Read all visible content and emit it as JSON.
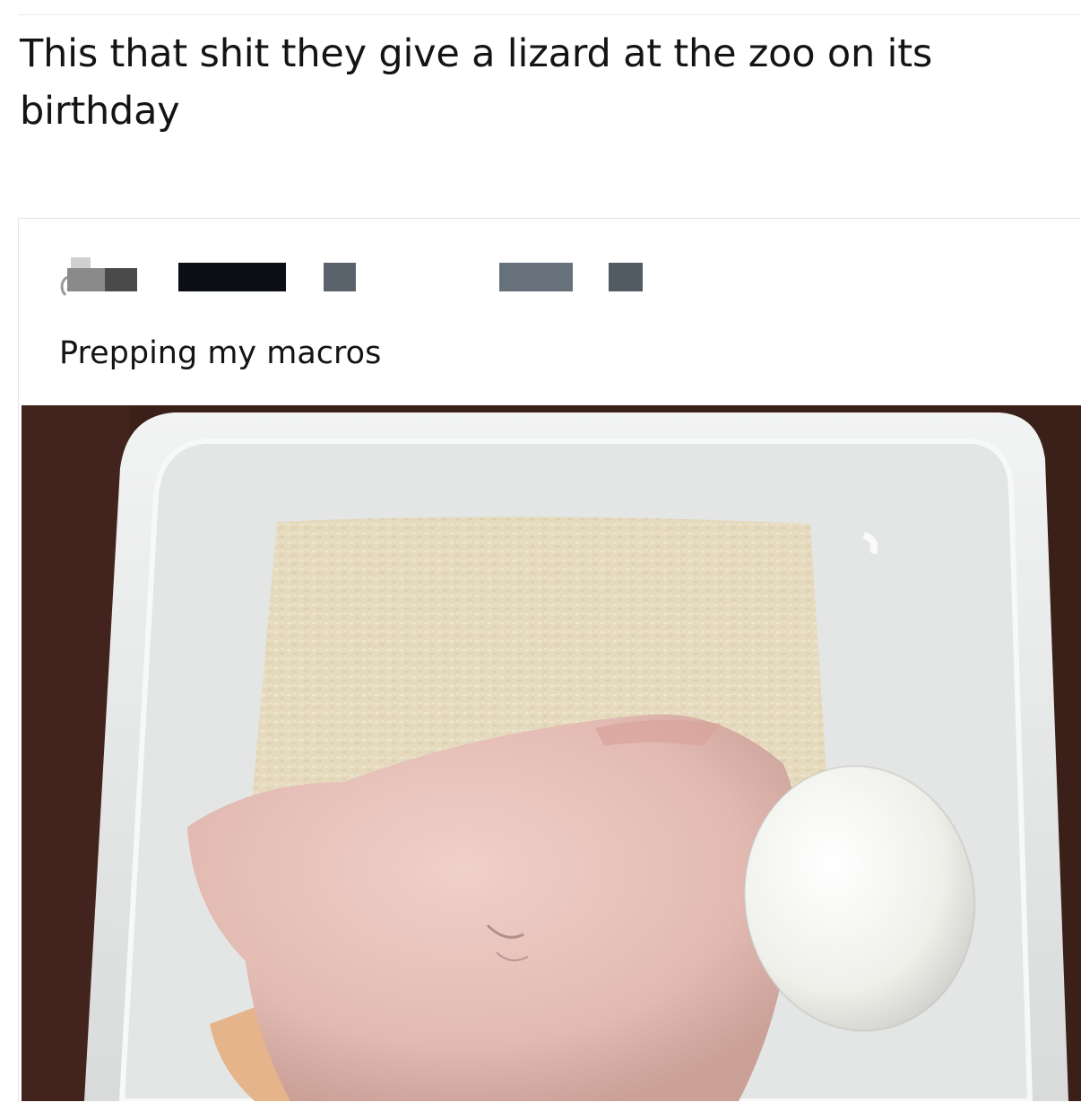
{
  "caption": {
    "text": "This that shit they give a lizard at the zoo on its birthday"
  },
  "quoted_post": {
    "author_name": "",
    "author_handle": "",
    "text": "Prepping my macros",
    "photo": {
      "icon": "food-container-photo"
    }
  },
  "colors": {
    "text": "#141414",
    "background": "#ffffff",
    "tabletop": "#3b1f19",
    "container": "#e9eaea",
    "rice": "#e6dcc2",
    "chicken": "#e8c4bd",
    "egg": "#f4f4ef"
  }
}
